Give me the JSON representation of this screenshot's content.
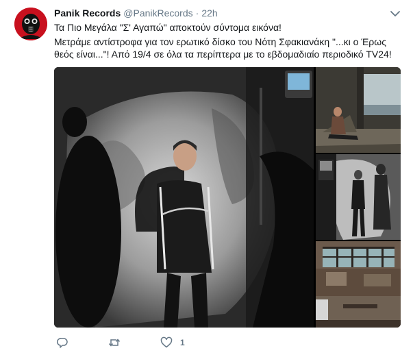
{
  "tweet": {
    "author_name": "Panik Records",
    "handle": "@PanikRecords",
    "separator": "·",
    "time": "22h",
    "text_line1": "Τα Πιο Μεγάλα \"Σ' Αγαπώ\" αποκτούν σύντομα εικόνα!",
    "text_line2": "Μετράμε αντίστροφα για τον ερωτικό δίσκο του Νότη Σφακιανάκη \"...κι ο Έρως θεός είναι...\"! Από 19/4 σε όλα τα περίπτερα με το εβδομαδιαίο περιοδικό TV24!",
    "like_count": "1"
  },
  "icons": {
    "avatar": "gas-mask-logo",
    "caret": "chevron-down-icon",
    "reply": "reply-icon",
    "retweet": "retweet-icon",
    "like": "heart-icon"
  },
  "colors": {
    "avatar_bg": "#d0021b",
    "text_primary": "#14171a",
    "text_secondary": "#657786"
  }
}
